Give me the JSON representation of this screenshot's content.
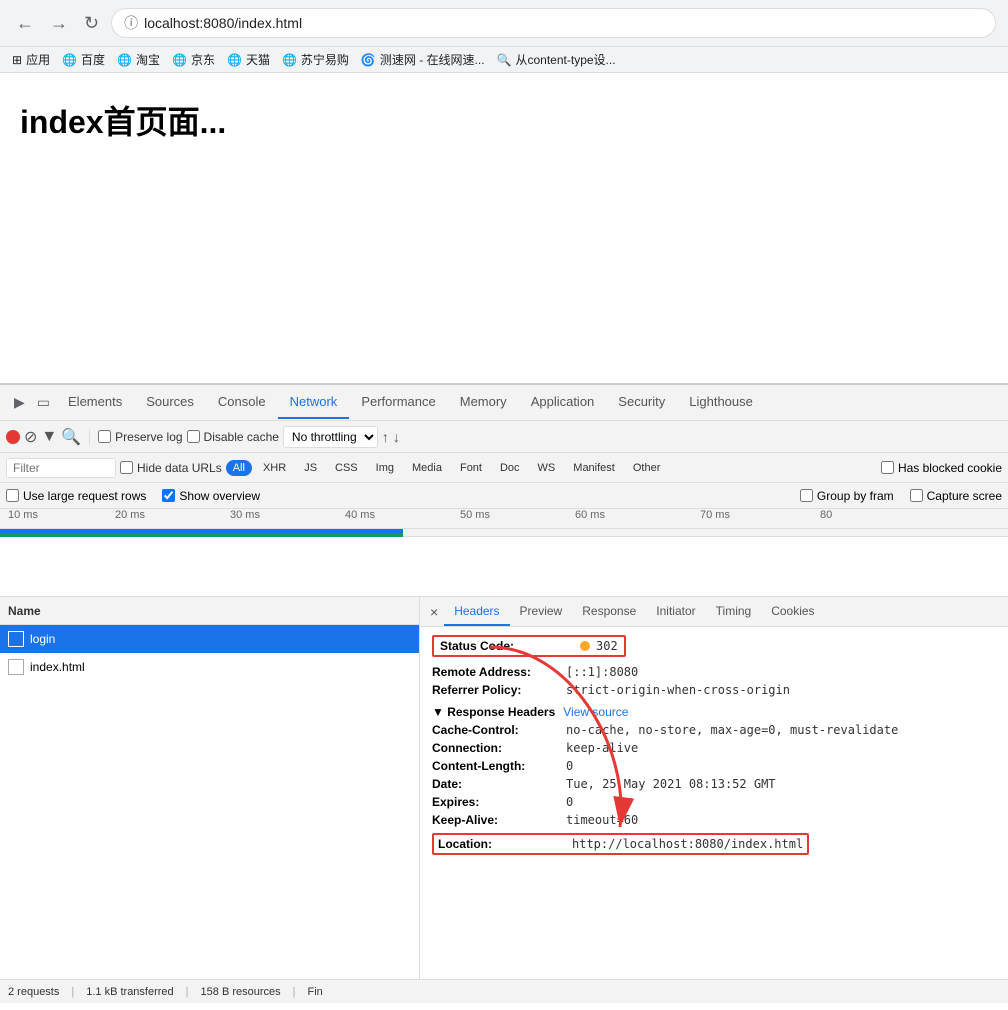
{
  "browser": {
    "nav": {
      "back_disabled": true,
      "forward_disabled": true
    },
    "address": "localhost:8080/index.html",
    "bookmarks": [
      {
        "icon": "⊞",
        "label": "应用"
      },
      {
        "icon": "🌐",
        "label": "百度"
      },
      {
        "icon": "🌐",
        "label": "淘宝"
      },
      {
        "icon": "🌐",
        "label": "京东"
      },
      {
        "icon": "🌐",
        "label": "天猫"
      },
      {
        "icon": "🌐",
        "label": "苏宁易购"
      },
      {
        "icon": "🌐",
        "label": "测速网 - 在线网速..."
      },
      {
        "icon": "🔍",
        "label": "从content-type设..."
      }
    ]
  },
  "page": {
    "title": "index首页面..."
  },
  "devtools": {
    "tabs": [
      {
        "label": "Elements",
        "active": false
      },
      {
        "label": "Sources",
        "active": false
      },
      {
        "label": "Console",
        "active": false
      },
      {
        "label": "Network",
        "active": true
      },
      {
        "label": "Performance",
        "active": false
      },
      {
        "label": "Memory",
        "active": false
      },
      {
        "label": "Application",
        "active": false
      },
      {
        "label": "Security",
        "active": false
      },
      {
        "label": "Lighthouse",
        "active": false
      }
    ],
    "toolbar": {
      "preserve_log": "Preserve log",
      "disable_cache": "Disable cache",
      "throttle": "No throttling"
    },
    "filter_bar": {
      "placeholder": "Filter",
      "hide_data_urls": "Hide data URLs",
      "all": "All",
      "types": [
        "XHR",
        "JS",
        "CSS",
        "Img",
        "Media",
        "Font",
        "Doc",
        "WS",
        "Manifest",
        "Other"
      ],
      "has_blocked": "Has blocked cookie"
    },
    "options": {
      "large_rows": "Use large request rows",
      "show_overview": "Show overview",
      "show_overview_checked": true,
      "large_rows_checked": false,
      "group_by_frame": "Group by fram",
      "capture_screen": "Capture scree"
    },
    "timeline": {
      "ticks": [
        "10 ms",
        "20 ms",
        "30 ms",
        "40 ms",
        "50 ms",
        "60 ms",
        "70 ms",
        "80"
      ]
    },
    "requests": [
      {
        "name": "login",
        "selected": true
      },
      {
        "name": "index.html",
        "selected": false
      }
    ],
    "detail": {
      "close_label": "×",
      "tabs": [
        {
          "label": "Headers",
          "active": true
        },
        {
          "label": "Preview",
          "active": false
        },
        {
          "label": "Response",
          "active": false
        },
        {
          "label": "Initiator",
          "active": false
        },
        {
          "label": "Timing",
          "active": false
        },
        {
          "label": "Cookies",
          "active": false
        }
      ],
      "headers": {
        "status_code_label": "Status Code:",
        "status_code_value": "302",
        "remote_address_label": "Remote Address:",
        "remote_address_value": "[::1]:8080",
        "referrer_policy_label": "Referrer Policy:",
        "referrer_policy_value": "strict-origin-when-cross-origin",
        "response_headers_title": "▼ Response Headers",
        "view_source": "View source",
        "cache_control_label": "Cache-Control:",
        "cache_control_value": "no-cache, no-store, max-age=0, must-revalidate",
        "connection_label": "Connection:",
        "connection_value": "keep-alive",
        "content_length_label": "Content-Length:",
        "content_length_value": "0",
        "date_label": "Date:",
        "date_value": "Tue, 25 May 2021 08:13:52 GMT",
        "expires_label": "Expires:",
        "expires_value": "0",
        "keep_alive_label": "Keep-Alive:",
        "keep_alive_value": "timeout=60",
        "location_label": "Location:",
        "location_value": "http://localhost:8080/index.html"
      }
    },
    "status_bar": {
      "requests": "2 requests",
      "transferred": "1.1 kB transferred",
      "resources": "158 B resources",
      "finish": "Fin"
    }
  }
}
